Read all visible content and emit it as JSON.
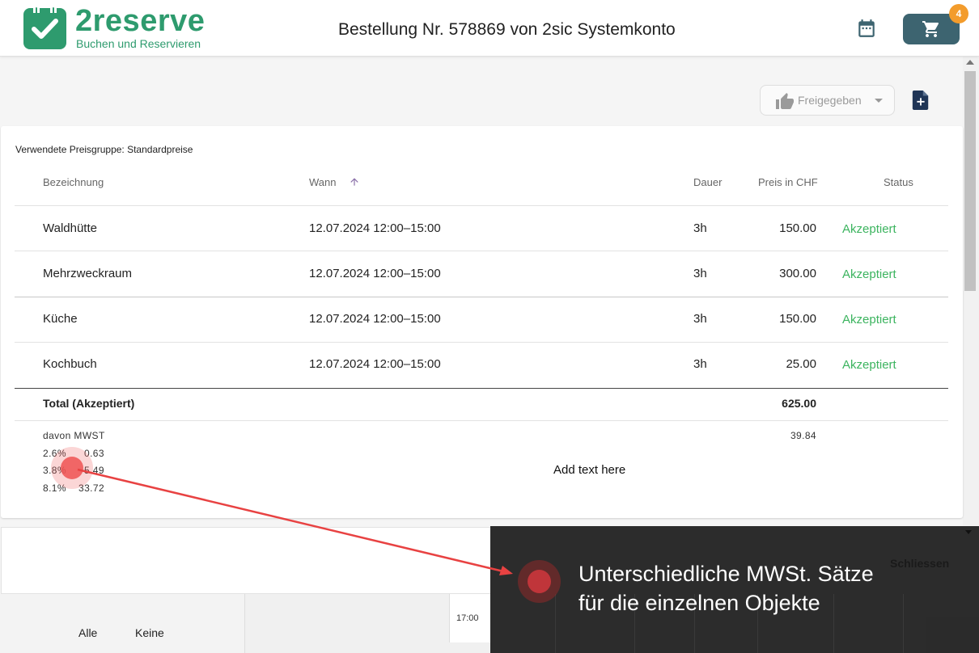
{
  "header": {
    "brand": "2reserve",
    "tagline": "Buchen und Reservieren",
    "order_title": "Bestellung Nr. 578869 von 2sic Systemkonto",
    "cart_count": "4"
  },
  "toolbar": {
    "approval_label": "Freigegeben"
  },
  "order": {
    "price_group": "Verwendete Preisgruppe: Standardpreise",
    "columns": [
      "Bezeichnung",
      "Wann",
      "Dauer",
      "Preis in CHF",
      "Status"
    ],
    "rows": [
      {
        "name": "Waldhütte",
        "when": "12.07.2024 12:00–15:00",
        "duration": "3h",
        "price": "150.00",
        "status": "Akzeptiert"
      },
      {
        "name": "Mehrzweckraum",
        "when": "12.07.2024 12:00–15:00",
        "duration": "3h",
        "price": "300.00",
        "status": "Akzeptiert"
      },
      {
        "name": "Küche",
        "when": "12.07.2024 12:00–15:00",
        "duration": "3h",
        "price": "150.00",
        "status": "Akzeptiert"
      },
      {
        "name": "Kochbuch",
        "when": "12.07.2024 12:00–15:00",
        "duration": "3h",
        "price": "25.00",
        "status": "Akzeptiert"
      }
    ],
    "total_label": "Total (Akzeptiert)",
    "total_value": "625.00",
    "vat_label": "davon MWST",
    "vat_total": "39.84",
    "vat_rates": [
      {
        "rate": "2.6%",
        "amount": "0.63"
      },
      {
        "rate": "3.8%",
        "amount": "5.49"
      },
      {
        "rate": "8.1%",
        "amount": "33.72"
      }
    ],
    "placeholder_text": "Add text here"
  },
  "footer": {
    "close_label": "Schliessen",
    "select_all": "Alle",
    "select_none": "Keine",
    "time_label": "17:00"
  },
  "tooltip": {
    "text": "Unterschiedliche MWSt. Sätze für die einzelnen Objekte"
  },
  "colors": {
    "brand": "#2e9b6e",
    "accepted": "#3cb45f",
    "cart_button": "#3d6470",
    "badge": "#f39c2c"
  }
}
